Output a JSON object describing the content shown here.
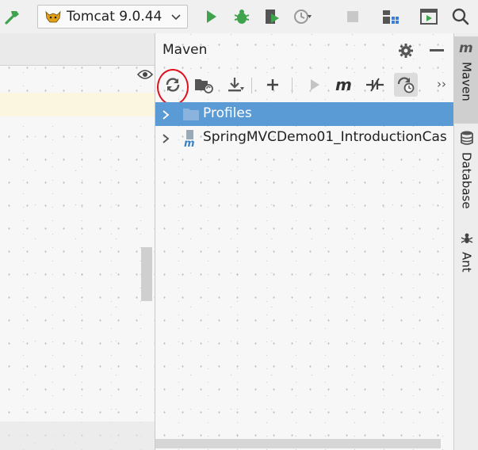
{
  "toolbar": {
    "run_config_label": "Tomcat 9.0.44"
  },
  "maven": {
    "title": "Maven",
    "tree": [
      {
        "label": "Profiles",
        "selected": true
      },
      {
        "label": "SpringMVCDemo01_IntroductionCas",
        "selected": false
      }
    ]
  },
  "side_tabs": {
    "maven": "Maven",
    "database": "Database",
    "ant": "Ant"
  },
  "colors": {
    "selection": "#5b9bd5",
    "run_green": "#3fa34d",
    "annotation_ring": "#e0101e"
  }
}
